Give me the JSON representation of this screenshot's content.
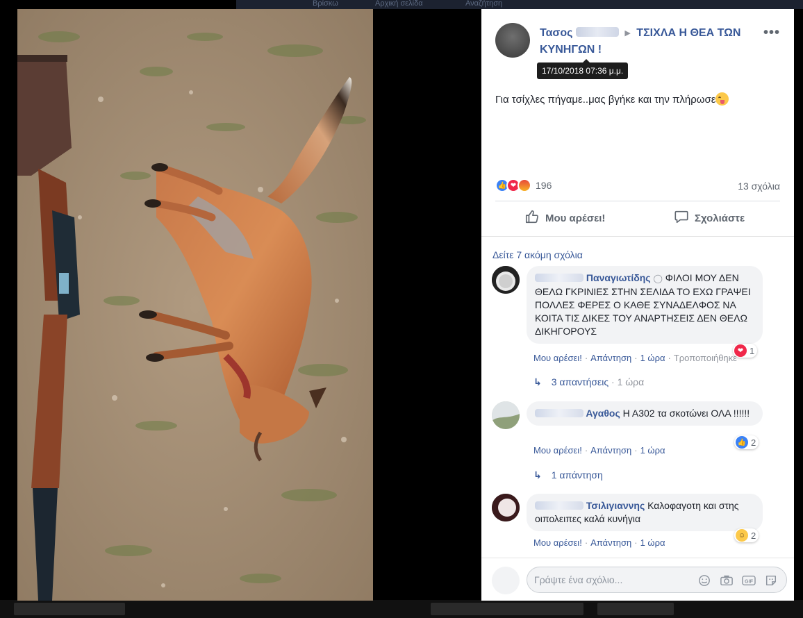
{
  "nav": {
    "items": [
      "Βρίσκω",
      "Αρχική σελίδα",
      "Αναζήτηση"
    ]
  },
  "post": {
    "author": "Τασος",
    "group": "ΤΣΙΧΛΑ Η ΘΕΑ ΤΩΝ ΚΥΝΗΓΩΝ !",
    "timestamp_tooltip": "17/10/2018 07:36 μ.μ.",
    "text": "Για τσίχλες πήγαμε..μας βγήκε και την πλήρωσε",
    "reaction_count": "196",
    "comments_count": "13 σχόλια",
    "like_label": "Μου αρέσει!",
    "comment_label": "Σχολιάστε"
  },
  "comments_section": {
    "see_more": "Δείτε 7 ακόμη σχόλια",
    "comments": [
      {
        "name": "Παναγιωτίδης",
        "text": "ΦΙΛΟΙ ΜΟΥ ΔΕΝ ΘΕΛΩ ΓΚΡΙΝΙΕΣ ΣΤΗΝ ΣΕΛΙΔΑ ΤΟ ΕΧΩ ΓΡΑΨΕΙ ΠΟΛΛΕΣ ΦΕΡΕΣ Ο ΚΑΘΕ ΣΥΝΑΔΕΛΦΟΣ ΝΑ ΚΟΙΤΑ ΤΙΣ ΔΙΚΕΣ ΤΟΥ ΑΝΑΡΤΗΣΕΙΣ ΔΕΝ ΘΕΛΩ ΔΙΚΗΓΟΡΟΥΣ",
        "reaction_count": "1",
        "like": "Μου αρέσει!",
        "reply": "Απάντηση",
        "time": "1 ώρα",
        "edited": "Τροποποιήθηκε",
        "replies": "3 απαντήσεις",
        "replies_time": "1 ώρα"
      },
      {
        "name": "Αγαθος",
        "text": "Η Α302 τα σκοτώνει ΟΛΑ !!!!!!",
        "reaction_count": "2",
        "like": "Μου αρέσει!",
        "reply": "Απάντηση",
        "time": "1 ώρα",
        "replies": "1 απάντηση"
      },
      {
        "name": "Τσιλιγιαννης",
        "text": "Καλοφαγοτη και στης οιπολειπες καλά κυνήγια",
        "reaction_count": "2",
        "like": "Μου αρέσει!",
        "reply": "Απάντηση",
        "time": "1 ώρα"
      }
    ]
  },
  "composer": {
    "placeholder": "Γράψτε ένα σχόλιο..."
  },
  "colors": {
    "link": "#385898",
    "meta": "#90949c",
    "bubble": "#f2f3f5"
  }
}
